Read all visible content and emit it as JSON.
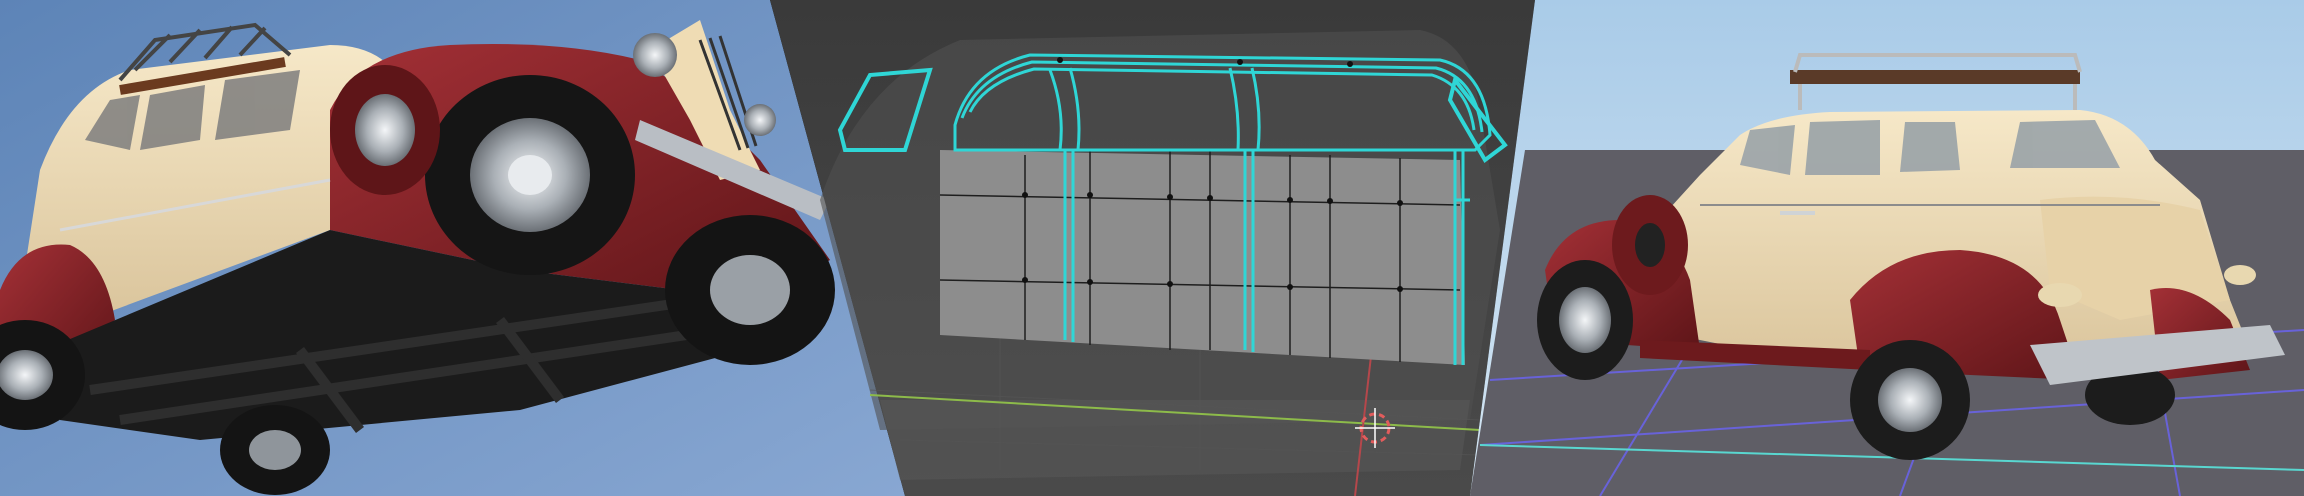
{
  "image": {
    "panels": [
      {
        "id": "left",
        "subject": "car-underside-view"
      },
      {
        "id": "middle",
        "subject": "wireframe-window-frame"
      },
      {
        "id": "right",
        "subject": "car-rear-three-quarter-view"
      }
    ],
    "colors": {
      "sky_left": "#6f95c8",
      "viewport_bg": "#3f3f3f",
      "cream": "#efdcb4",
      "maroon": "#7e2124",
      "chrome": "#c8cdd2",
      "wire_cyan": "#2fd6d6",
      "floor_grid": "#6a63e6",
      "sky_right": "#b9d6ee",
      "ground_right": "#5d5c63"
    }
  }
}
